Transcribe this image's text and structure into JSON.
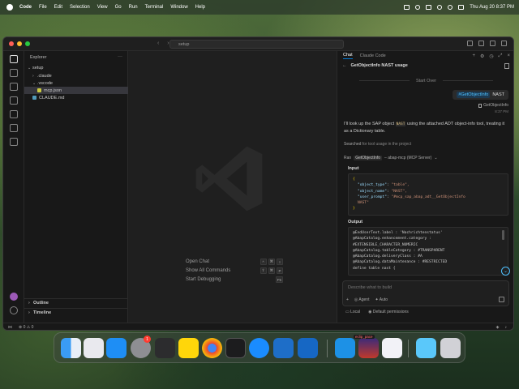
{
  "menubar": {
    "app": "Code",
    "items": [
      "File",
      "Edit",
      "Selection",
      "View",
      "Go",
      "Run",
      "Terminal",
      "Window",
      "Help"
    ],
    "datetime": "Thu Aug 20  8:37 PM"
  },
  "window": {
    "search": "setup"
  },
  "explorer": {
    "title": "Explorer",
    "root": "setup",
    "items": [
      {
        "label": ".claude",
        "type": "folder"
      },
      {
        "label": ".vscode",
        "type": "folder"
      },
      {
        "label": "mcp.json",
        "type": "json-file"
      },
      {
        "label": "CLAUDE.md",
        "type": "md-file"
      }
    ],
    "outline": "Outline",
    "timeline": "Timeline"
  },
  "editor": {
    "shortcuts": [
      {
        "label": "Open Chat",
        "keys": [
          "^",
          "⌘",
          "I"
        ]
      },
      {
        "label": "Show All Commands",
        "keys": [
          "⇧",
          "⌘",
          "P"
        ]
      },
      {
        "label": "Start Debugging",
        "keys": [
          "F5"
        ]
      }
    ]
  },
  "chat": {
    "tabs": [
      "Chat",
      "Claude Code"
    ],
    "header": "GetObjectInfo NAST usage",
    "start_over": "Start Over",
    "user_message": {
      "tag": "#GetObjectInfo",
      "text": "NAST"
    },
    "attachment": "GetObjectInfo",
    "time": "8:37 PM",
    "reply_part1": "I'll look up the SAP object",
    "reply_code": "NAST",
    "reply_part2": "using the attached ADT object-info tool, treating it as a Dictionary table.",
    "searched_label": "Searched",
    "searched_text": "for tool usage in the project",
    "ran_label": "Ran",
    "ran_tool": "GetObjectInfo",
    "ran_server": "– abap-mcp (MCP Server)",
    "input_label": "Input",
    "input_json": [
      {
        "key": "\"object_type\"",
        "value": "\"table\","
      },
      {
        "key": "\"object_name\"",
        "value": "\"NAST\","
      },
      {
        "key": "\"user_prompt\"",
        "value": "\"#mcp_sap_abap_adt__GetObjectInfo"
      },
      {
        "key": "",
        "value": "NAST\""
      }
    ],
    "output_label": "Output",
    "output_lines": [
      "@EndUserText.label : 'Nachrichtenstatus'",
      "@AbapCatalog.enhancement.category :",
      "#EXTENSIBLE_CHARACTER_NUMERIC",
      "@AbapCatalog.tableCategory : #TRANSPARENT",
      "@AbapCatalog.deliveryClass : #A",
      "@AbapCatalog.dataMaintenance : #RESTRICTED",
      "define table nast {"
    ],
    "input_placeholder": "Describe what to build",
    "mode_agent": "Agent",
    "mode_auto": "Auto",
    "footer_local": "Local",
    "footer_permissions": "Default permissions"
  },
  "statusbar": {
    "errors": "0",
    "warnings": "0"
  },
  "dock": {
    "badge": "1",
    "running_label": "eclip_pace"
  }
}
